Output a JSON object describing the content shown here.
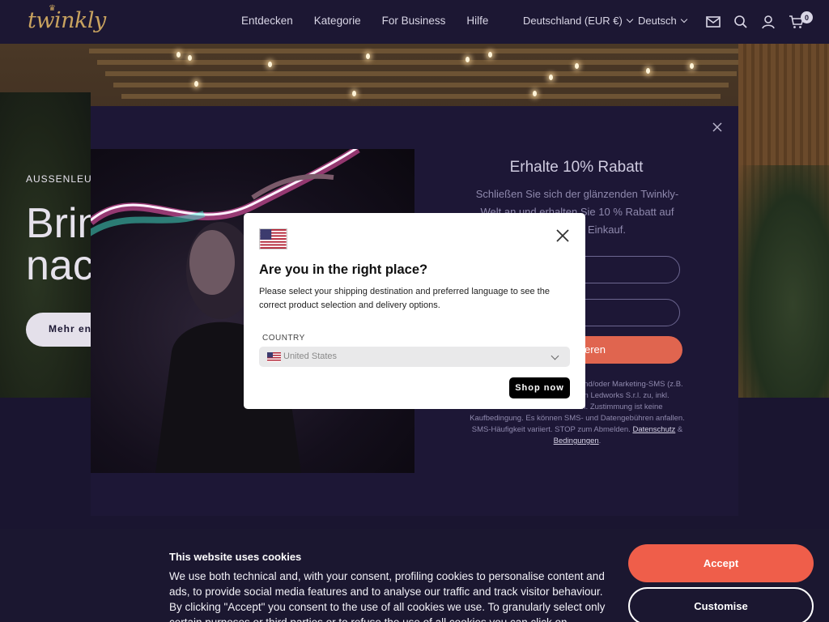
{
  "header": {
    "logo": "twinkly",
    "nav": [
      "Entdecken",
      "Kategorie",
      "For Business",
      "Hilfe"
    ],
    "region": "Deutschland (EUR €)",
    "language": "Deutsch",
    "icons": [
      "mail-icon",
      "search-icon",
      "account-icon",
      "cart-icon"
    ],
    "cart_count": "0"
  },
  "hero": {
    "eyebrow": "AUSSENLEUC",
    "title_line1": "Brin",
    "title_line2": "nac",
    "button": "Mehr en"
  },
  "promo": {
    "title": "Erhalte 10% Rabatt",
    "subtitle": "Schließen Sie sich der glänzenden Twinkly-Welt an und erhalten Sie 10 % Rabatt auf Ihren ersten Einkauf.",
    "submit_label": "eren",
    "legal_text": "mulars stimmen Sie dem tates) und/oder Marketing-SMS (z.B. Warenkorb-Erinnerungen) von Ledworks S.r.l. zu, inkl. automatisierter Nachrichten. Zustimmung ist keine Kaufbedingung. Es können SMS- und Datengebühren anfallen. SMS-Häufigkeit variiert. STOP zum Abmelden.",
    "privacy_link": "Datenschutz",
    "amp": "&",
    "terms_link": "Bedingungen",
    "period": "."
  },
  "modal": {
    "title": "Are you in the right place?",
    "description": "Please select your shipping destination and preferred language to see the correct product selection and delivery options.",
    "country_label": "COUNTRY",
    "country_value": "United States",
    "shop_button": "Shop now"
  },
  "cookie": {
    "title": "This website uses cookies",
    "text": "We use both technical and, with your consent, profiling cookies to personalise content and ads, to provide social media features and to analyse our traffic and track visitor behaviour. By clicking \"Accept\" you consent to the use of all cookies we use. To granularly select only certain purposes or third parties or to refuse the use of all cookies you can click on",
    "accept": "Accept",
    "customise": "Customise"
  },
  "colors": {
    "accent": "#ef5e4a",
    "header_bg": "#1c1733",
    "logo_gold": "#c9a35f"
  }
}
